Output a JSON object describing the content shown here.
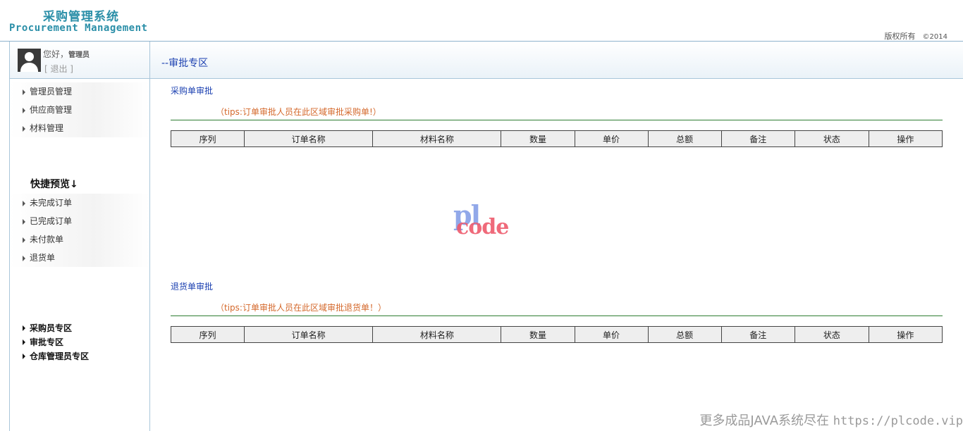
{
  "header": {
    "title_cn": "采购管理系统",
    "title_en": "Procurement Management",
    "copyright": "版权所有",
    "year": "©2014"
  },
  "user": {
    "greeting": "您好，",
    "name": "管理员",
    "logout": "[ 退出 ]"
  },
  "sidebar": {
    "menu": [
      {
        "label": "管理员管理"
      },
      {
        "label": "供应商管理"
      },
      {
        "label": "材料管理"
      }
    ],
    "quick_title": "快捷预览↓",
    "quick": [
      {
        "label": "未完成订单"
      },
      {
        "label": "已完成订单"
      },
      {
        "label": "未付款单"
      },
      {
        "label": "退货单"
      }
    ],
    "zones": [
      {
        "label": "采购员专区"
      },
      {
        "label": "审批专区"
      },
      {
        "label": "仓库管理员专区"
      }
    ]
  },
  "main": {
    "title": "--审批专区",
    "purchase": {
      "title": "采购单审批",
      "tips": "（tips:订单审批人员在此区域审批采购单!）"
    },
    "returns": {
      "title": "退货单审批",
      "tips": "（tips:订单审批人员在此区域审批退货单！）"
    },
    "columns": [
      "序列",
      "订单名称",
      "材料名称",
      "数量",
      "单价",
      "总额",
      "备注",
      "状态",
      "操作"
    ]
  },
  "watermark": {
    "line1": "pl",
    "line2": "code"
  },
  "footer": {
    "text": "更多成品JAVA系统尽在 ",
    "url": "https://plcode.vip"
  },
  "colors": {
    "brand": "#2b8fa8",
    "link": "#1a3fb0",
    "tips": "#d4682b",
    "divider": "#2e7d32"
  }
}
